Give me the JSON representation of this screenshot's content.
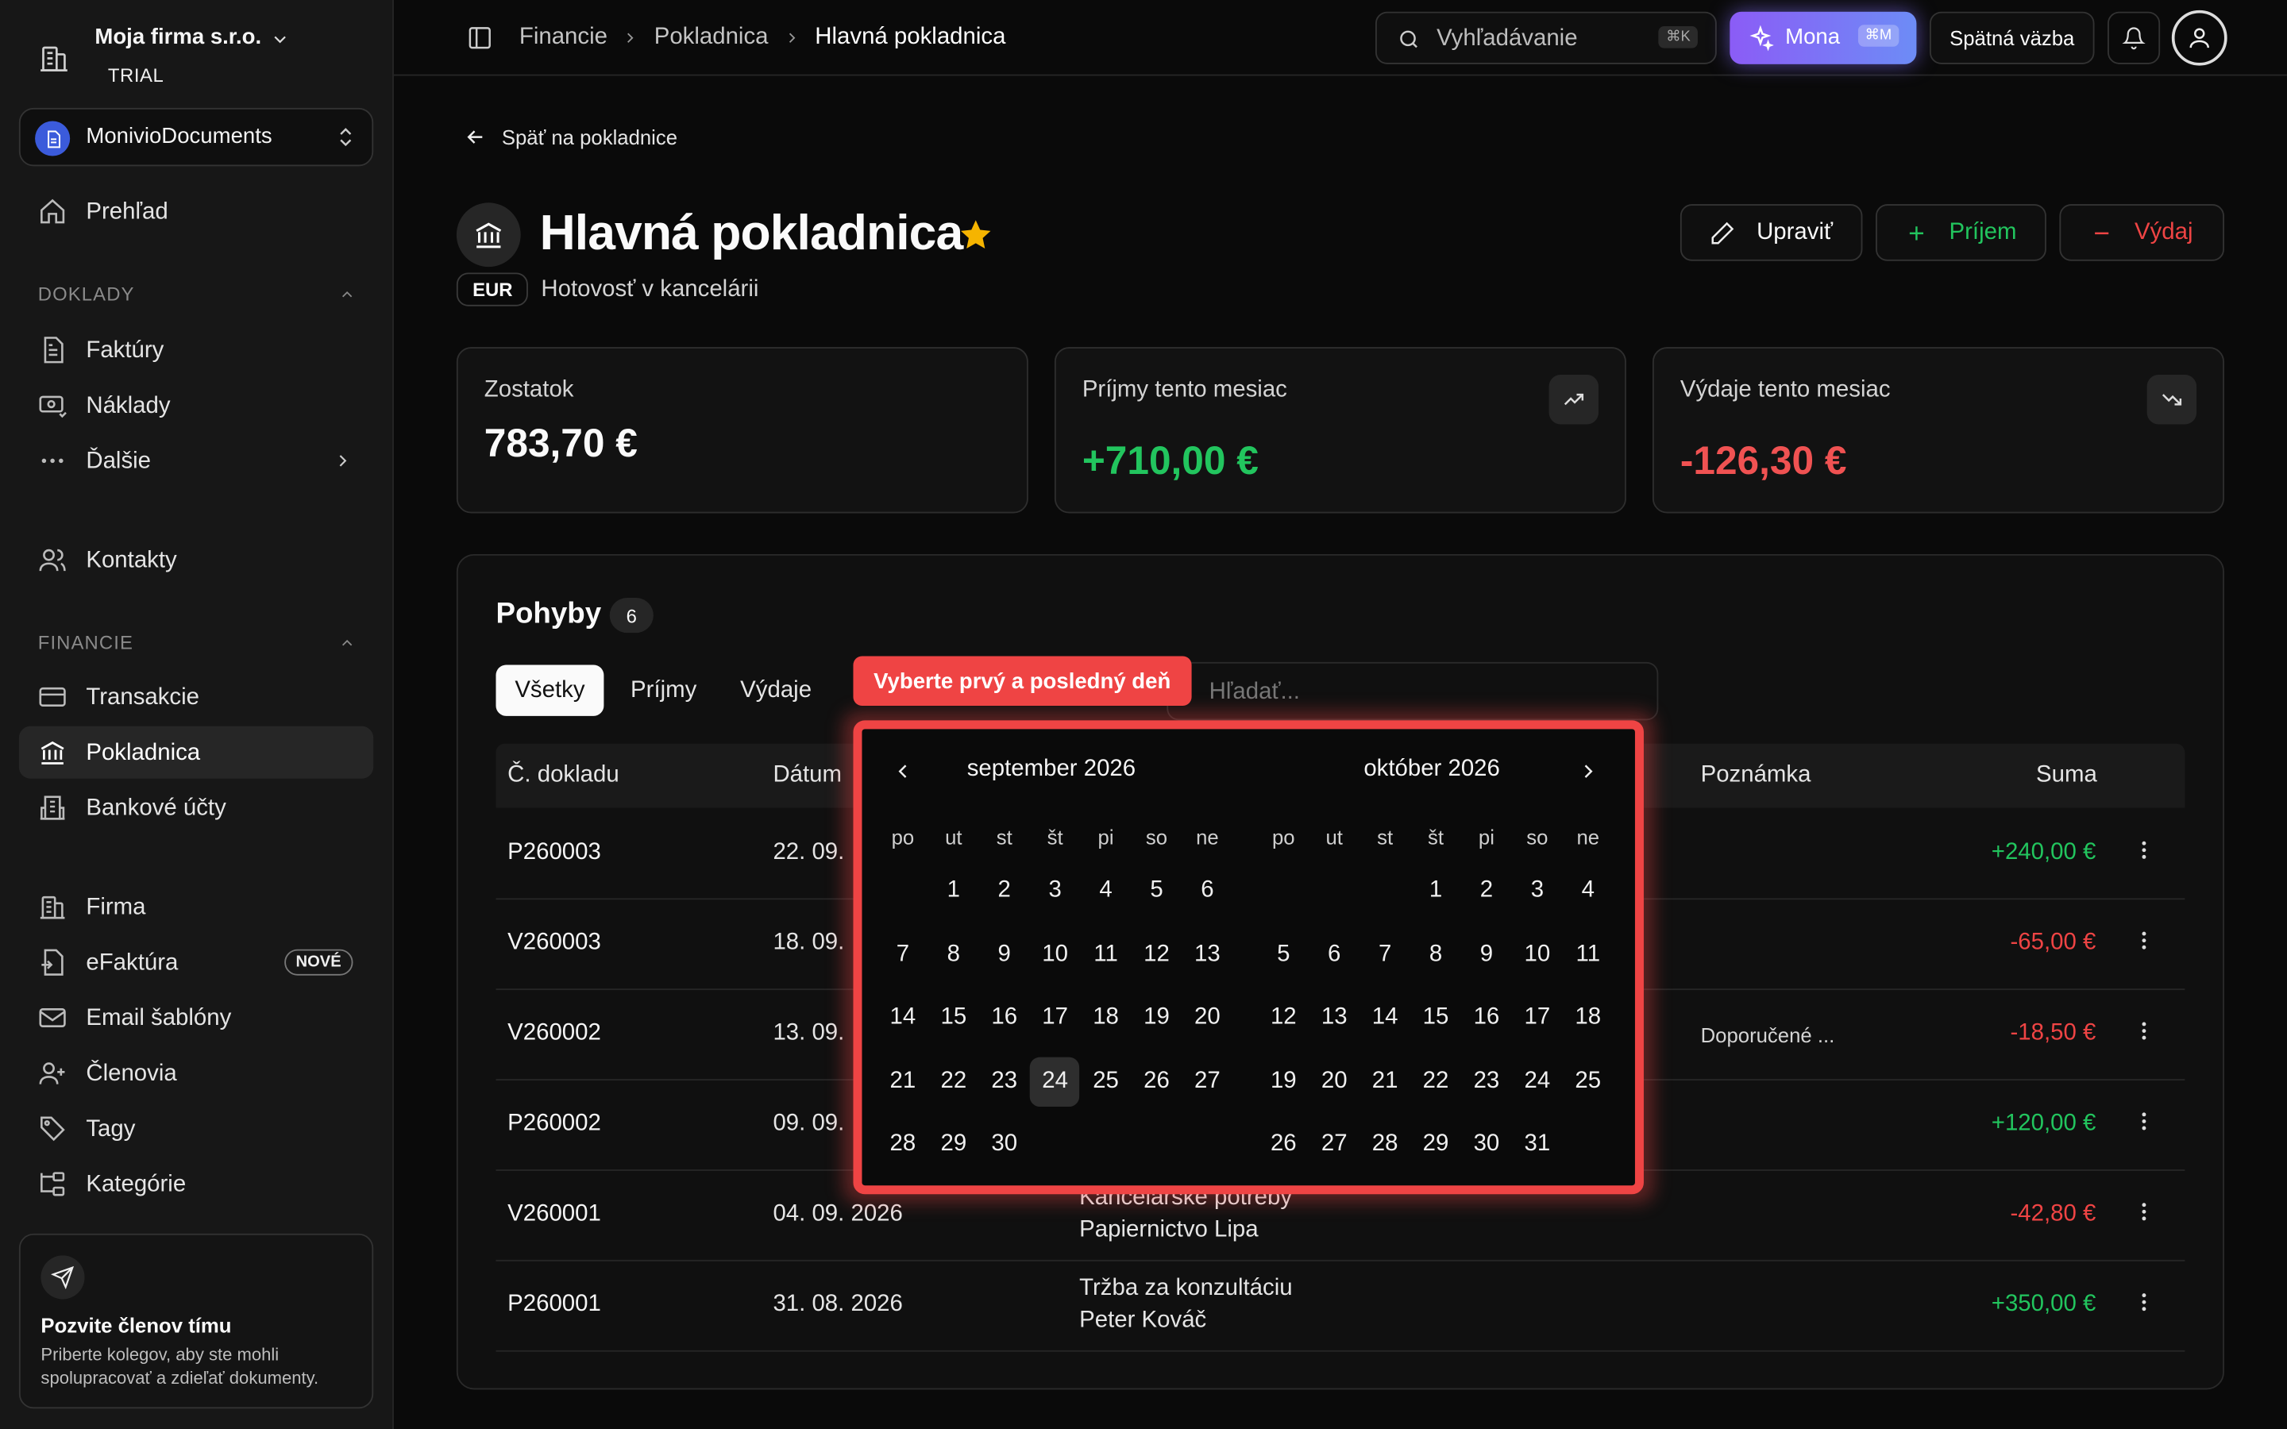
{
  "sidebar": {
    "company": "Moja firma s.r.o.",
    "plan": "TRIAL",
    "workspace": "MonivioDocuments",
    "overview": "Prehľad",
    "section_docs": "DOKLADY",
    "invoices": "Faktúry",
    "costs": "Náklady",
    "more": "Ďalšie",
    "contacts": "Kontakty",
    "section_finance": "FINANCIE",
    "transactions": "Transakcie",
    "cashbox": "Pokladnica",
    "bank_accounts": "Bankové účty",
    "company_item": "Firma",
    "einvoice": "eFaktúra",
    "new_badge": "NOVÉ",
    "email_templates": "Email šablóny",
    "members": "Členovia",
    "tags": "Tagy",
    "categories": "Kategórie",
    "invite_title": "Pozvite členov tímu",
    "invite_desc": "Priberte kolegov, aby ste mohli spolupracovať a zdieľať dokumenty."
  },
  "topbar": {
    "crumb1": "Financie",
    "crumb2": "Pokladnica",
    "crumb3": "Hlavná pokladnica",
    "search_placeholder": "Vyhľadávanie",
    "search_kbd": "⌘K",
    "mona": "Mona",
    "mona_kbd": "⌘M",
    "feedback": "Spätná väzba"
  },
  "page": {
    "back": "Späť na pokladnice",
    "title": "Hlavná pokladnica",
    "currency": "EUR",
    "subtitle": "Hotovosť v kancelárii",
    "edit": "Upraviť",
    "income_btn": "Príjem",
    "expense_btn": "Výdaj"
  },
  "stats": {
    "balance_label": "Zostatok",
    "balance": "783,70 €",
    "income_label": "Príjmy tento mesiac",
    "income": "+710,00 €",
    "expense_label": "Výdaje tento mesiac",
    "expense": "-126,30 €"
  },
  "movements": {
    "title": "Pohyby",
    "count": "6",
    "tab_all": "Všetky",
    "tab_income": "Príjmy",
    "tab_expense": "Výdaje",
    "search_placeholder": "Hľadať...",
    "col_doc": "Č. dokladu",
    "col_date": "Dátum",
    "col_note": "Poznámka",
    "col_amount": "Suma",
    "rows": [
      {
        "doc": "P260003",
        "date": "22. 09.",
        "desc1": "",
        "desc2": "",
        "note": "",
        "amount": "+240,00 €",
        "sign": "pos"
      },
      {
        "doc": "V260003",
        "date": "18. 09.",
        "desc1": "",
        "desc2": "",
        "note": "",
        "amount": "-65,00 €",
        "sign": "neg"
      },
      {
        "doc": "V260002",
        "date": "13. 09.",
        "desc1": "",
        "desc2": "",
        "note": "Doporučené ...",
        "amount": "-18,50 €",
        "sign": "neg"
      },
      {
        "doc": "P260002",
        "date": "09. 09.",
        "desc1": "",
        "desc2": "",
        "note": "",
        "amount": "+120,00 €",
        "sign": "pos"
      },
      {
        "doc": "V260001",
        "date": "04. 09. 2026",
        "desc1": "Kancelárske potreby",
        "desc2": "Papiernictvo Lipa",
        "note": "",
        "amount": "-42,80 €",
        "sign": "neg"
      },
      {
        "doc": "P260001",
        "date": "31. 08. 2026",
        "desc1": "Tržba za konzultáciu",
        "desc2": "Peter Kováč",
        "note": "",
        "amount": "+350,00 €",
        "sign": "pos"
      }
    ]
  },
  "datepicker": {
    "label": "Vyberte prvý a posledný deň",
    "selected_day": "24",
    "weekdays": [
      "po",
      "ut",
      "st",
      "št",
      "pi",
      "so",
      "ne"
    ],
    "months": [
      {
        "title": "september 2026",
        "first_weekday": 1,
        "days": 30
      },
      {
        "title": "október 2026",
        "first_weekday": 3,
        "days": 31
      }
    ]
  },
  "colors": {
    "accent": "#ef4444",
    "positive": "#22c55e",
    "highlight": "#f5b400",
    "mona": "#8b5cf6"
  }
}
